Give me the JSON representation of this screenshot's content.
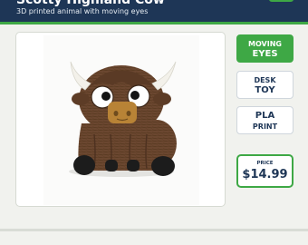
{
  "header": {
    "title": "Scotty Highland Cow",
    "subtitle": "3D printed animal with moving eyes"
  },
  "features": [
    {
      "line1": "MOVING",
      "line2": "EYES"
    },
    {
      "line1": "DESK",
      "line2": "TOY"
    },
    {
      "line1": "PLA",
      "line2": "PRINT"
    }
  ],
  "price": {
    "label": "PRICE",
    "value": "$14.99"
  },
  "colors": {
    "navy": "#1e3656",
    "accent_green": "#3ea845",
    "fur_brown": "#6b4730",
    "horn": "#f3f1ea"
  },
  "image": {
    "icon": "highland-cow-toy-photo"
  }
}
